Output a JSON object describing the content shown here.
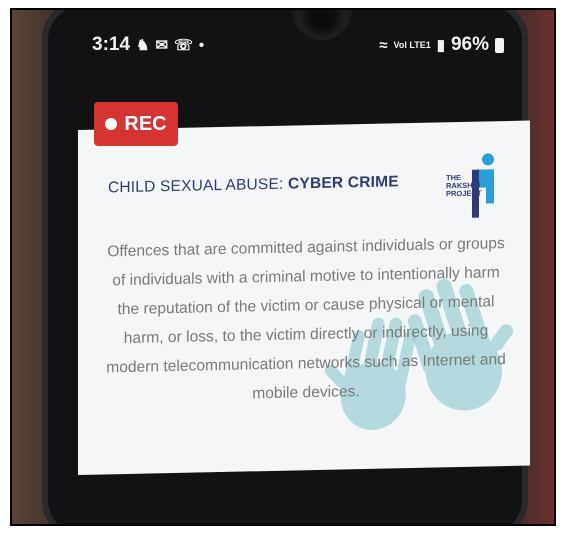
{
  "status_bar": {
    "time": "3:14",
    "network": "Vol LTE1",
    "battery": "96%"
  },
  "recording": {
    "label": "REC"
  },
  "slide": {
    "title_prefix": "CHILD SEXUAL ABUSE: ",
    "title_emphasis": "CYBER CRIME",
    "logo_lines": [
      "THE",
      "RAKSHIN",
      "PROJECT"
    ],
    "body": "Offences that are committed against individuals or groups of individuals with a criminal motive to intentionally harm the reputation of the victim or cause physical or mental harm, or loss, to the victim directly or indirectly, using modern telecommunication networks such as Internet and mobile devices."
  },
  "colors": {
    "rec_badge": "#d63431",
    "title": "#2e3a7a",
    "logo_accent": "#2a9ed8",
    "handprint": "#7fc4c9"
  }
}
